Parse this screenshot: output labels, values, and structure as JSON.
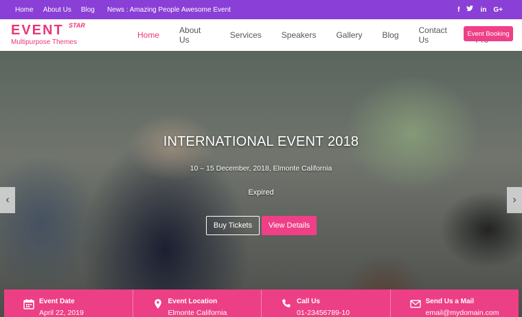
{
  "topbar": {
    "links": [
      "Home",
      "About Us",
      "Blog"
    ],
    "news": "News : Amazing People Awesome Event",
    "social": [
      "f",
      "t",
      "in",
      "G+"
    ]
  },
  "logo": {
    "word": "EVENT",
    "star": "STAR",
    "tagline": "Multipurpose Themes"
  },
  "nav": {
    "items": [
      "Home",
      "About Us",
      "Services",
      "Speakers",
      "Gallery",
      "Blog",
      "Contact Us",
      "Buy Pro"
    ],
    "active": "Home",
    "booking_label": "Event Booking"
  },
  "hero": {
    "title": "INTERNATIONAL EVENT 2018",
    "date_location": "10 – 15 December, 2018, Elmonte California",
    "status": "Expired",
    "tickets_label": "Buy Tickets",
    "details_label": "View Details",
    "prev": "‹",
    "next": "›"
  },
  "info": [
    {
      "title": "Event Date",
      "value": "April 22, 2019",
      "icon": "calendar-icon"
    },
    {
      "title": "Event Location",
      "value": "Elmonte California",
      "icon": "map-pin-icon"
    },
    {
      "title": "Call Us",
      "value": "01-23456789-10",
      "icon": "phone-icon"
    },
    {
      "title": "Send Us a Mail",
      "value": "email@mydomain.com",
      "icon": "envelope-icon"
    }
  ],
  "colors": {
    "topbar": "#8a3fd6",
    "accent": "#ef3f86"
  }
}
